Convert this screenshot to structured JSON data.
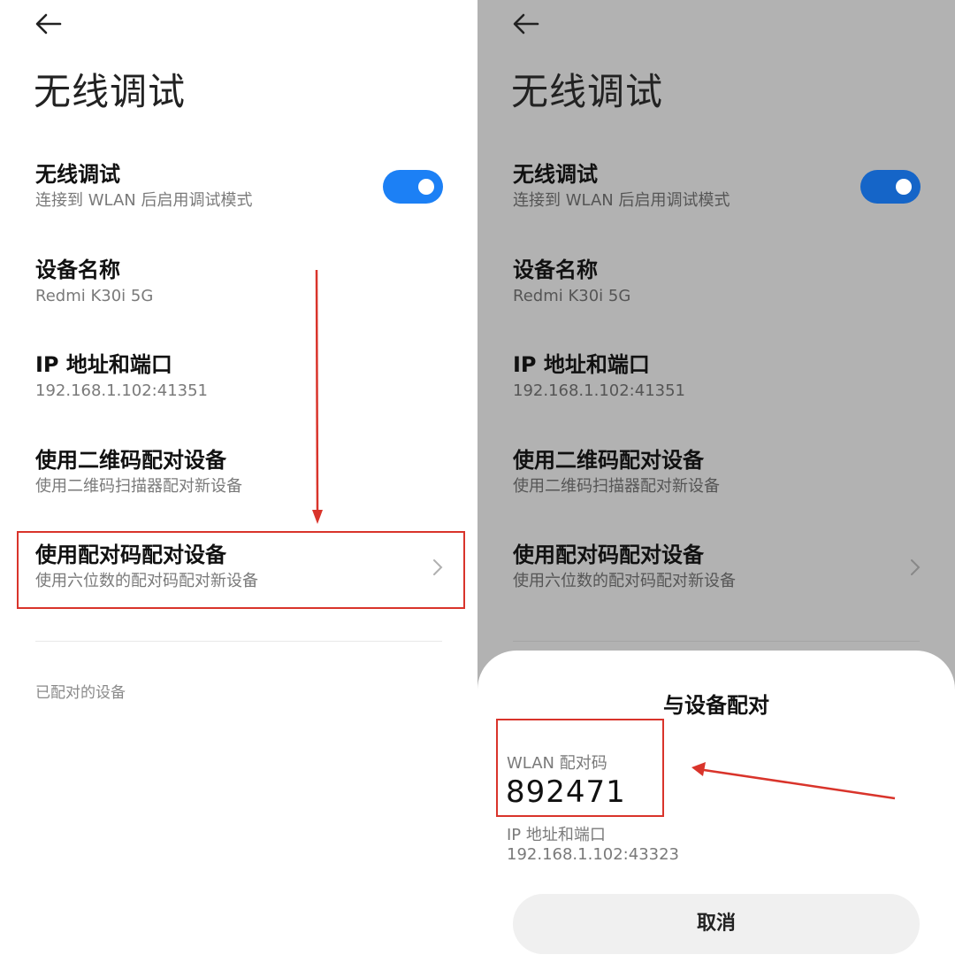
{
  "left": {
    "title": "无线调试",
    "wireless": {
      "title": "无线调试",
      "subtitle": "连接到 WLAN 后启用调试模式",
      "toggle_on": true
    },
    "device_name": {
      "title": "设备名称",
      "value": "Redmi K30i 5G"
    },
    "ip_port": {
      "title": "IP 地址和端口",
      "value": "192.168.1.102:41351"
    },
    "qr_pair": {
      "title": "使用二维码配对设备",
      "subtitle": "使用二维码扫描器配对新设备"
    },
    "code_pair": {
      "title": "使用配对码配对设备",
      "subtitle": "使用六位数的配对码配对新设备"
    },
    "paired_header": "已配对的设备"
  },
  "right": {
    "title": "无线调试",
    "wireless": {
      "title": "无线调试",
      "subtitle": "连接到 WLAN 后启用调试模式",
      "toggle_on": true
    },
    "device_name": {
      "title": "设备名称",
      "value": "Redmi K30i 5G"
    },
    "ip_port": {
      "title": "IP 地址和端口",
      "value": "192.168.1.102:41351"
    },
    "qr_pair": {
      "title": "使用二维码配对设备",
      "subtitle": "使用二维码扫描器配对新设备"
    },
    "code_pair": {
      "title": "使用配对码配对设备",
      "subtitle": "使用六位数的配对码配对新设备"
    },
    "dialog": {
      "title": "与设备配对",
      "code_label": "WLAN 配对码",
      "code_value": "892471",
      "ip_label": "IP 地址和端口",
      "ip_value": "192.168.1.102:43323",
      "cancel_label": "取消"
    }
  },
  "colors": {
    "accent": "#1c80f5",
    "annotation": "#d9342b",
    "dim_background": "#b2b2b2"
  },
  "icons": {
    "back": "back-arrow-icon",
    "chevron": "chevron-right-icon"
  }
}
